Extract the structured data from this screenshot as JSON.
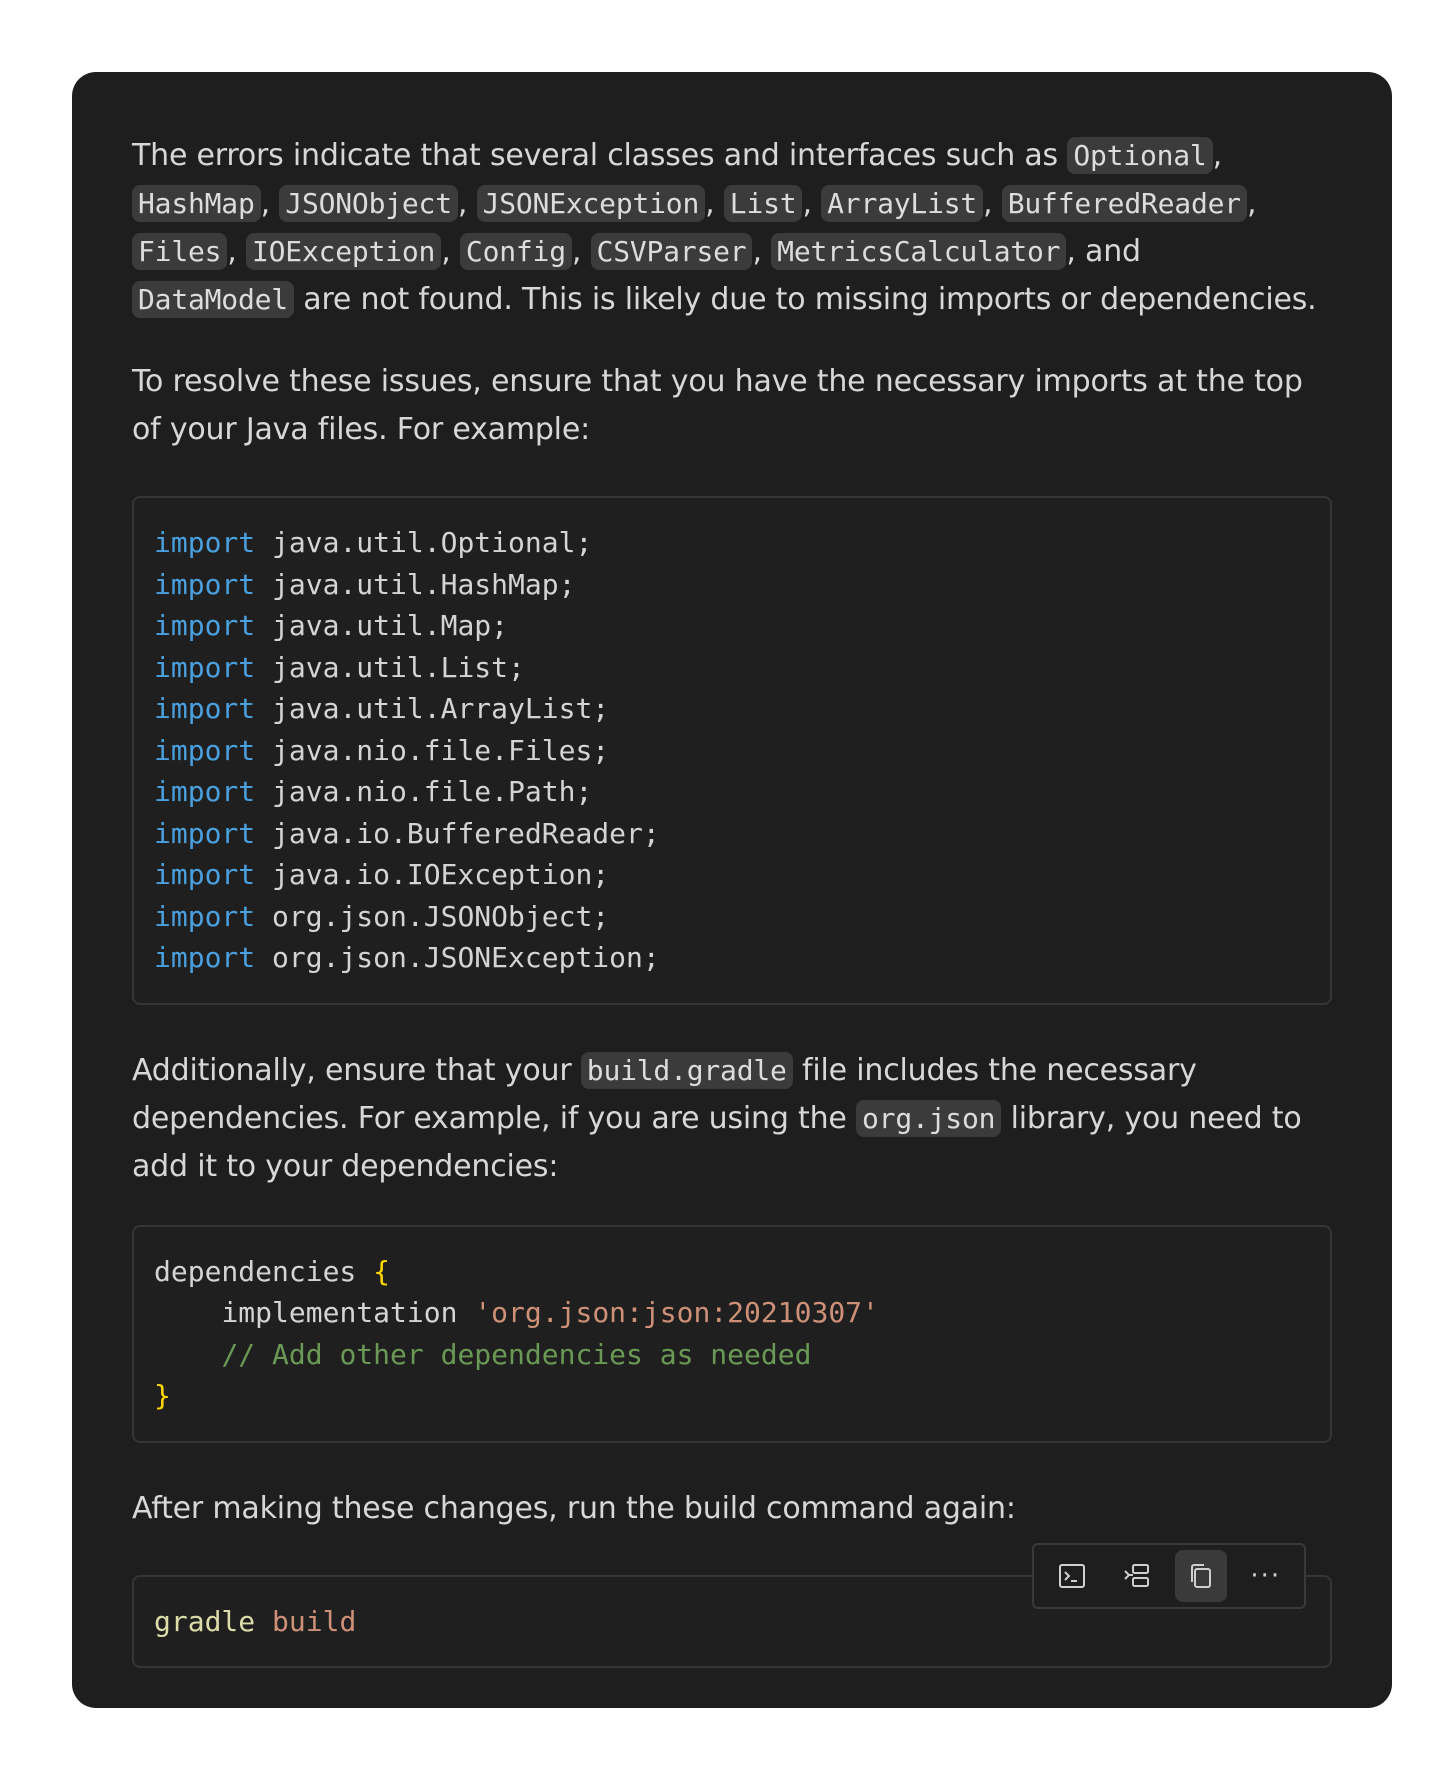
{
  "intro": {
    "p1_lead": "The errors indicate that several classes and interfaces such as ",
    "c_optional": "Optional",
    "c_hashmap": "HashMap",
    "c_jsonobject": "JSONObject",
    "c_jsonexception": "JSONException",
    "c_list": "List",
    "c_arraylist": "ArrayList",
    "c_bufferedreader": "BufferedReader",
    "c_files": "Files",
    "c_ioexception": "IOException",
    "c_config": "Config",
    "c_csvparser": "CSVParser",
    "c_metricscalculator": "MetricsCalculator",
    "c_datamodel": "DataModel",
    "comma": ",",
    "and": ", and",
    "p1_tail": " are not found. This is likely due to missing imports or dependencies.",
    "p2": "To resolve these issues, ensure that you have the necessary imports at the top of your Java files. For example:"
  },
  "imports_block": {
    "keyword": "import",
    "lines": [
      "java.util.Optional;",
      "java.util.HashMap;",
      "java.util.Map;",
      "java.util.List;",
      "java.util.ArrayList;",
      "java.nio.file.Files;",
      "java.nio.file.Path;",
      "java.io.BufferedReader;",
      "java.io.IOException;",
      "org.json.JSONObject;",
      "org.json.JSONException;"
    ]
  },
  "gradle_para": {
    "lead": "Additionally, ensure that your ",
    "c_build_gradle": "build.gradle",
    "mid": " file includes the necessary dependencies. For example, if you are using the ",
    "c_org_json": "org.json",
    "tail": " library, you need to add it to your dependencies:"
  },
  "deps_block": {
    "dependencies": "dependencies",
    "open_brace": "{",
    "implementation": "implementation",
    "artifact": "'org.json:json:20210307'",
    "comment": "// Add other dependencies as needed",
    "close_brace": "}"
  },
  "final_para": "After making these changes, run the build command again:",
  "build_block": {
    "command": "gradle",
    "argument": "build"
  },
  "toolbar": {
    "icons": [
      "terminal-icon",
      "insert-icon",
      "copy-icon",
      "more-icon"
    ],
    "more_label": "···"
  }
}
